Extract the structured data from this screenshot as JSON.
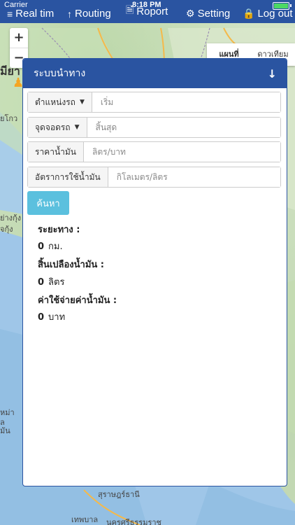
{
  "status": {
    "carrier": "Carrier",
    "time": "8:18 PM"
  },
  "nav": {
    "items": [
      {
        "label": "Real tim",
        "icon": "rss-icon"
      },
      {
        "label": "Routing",
        "icon": "arrow-up-icon"
      },
      {
        "label": "Roport",
        "icon": "document-icon"
      },
      {
        "label": "Setting",
        "icon": "gears-icon"
      },
      {
        "label": "Log out",
        "icon": "lock-icon"
      }
    ]
  },
  "map": {
    "zoom_in": "+",
    "zoom_out": "−",
    "map_type_options": [
      "แผนที่",
      "ดาวเทียม"
    ],
    "places": [
      "มียา",
      "ยโกว",
      "ย่างกุ้ง",
      "จกุ้ง",
      "เทพบาล",
      "นครศรีธรรมราช",
      "สุราษฎร์ธานี",
      "หม่า",
      "ล",
      "มัน"
    ]
  },
  "panel": {
    "title": "ระบบนำทาง",
    "collapse_icon": "arrow-down-icon",
    "start": {
      "dropdown": "ตำแหน่งรถ",
      "placeholder": "เริ่ม"
    },
    "end": {
      "dropdown": "จุดจอดรถ",
      "placeholder": "สิ้นสุด"
    },
    "fuel_price": {
      "label": "ราคาน้ำมัน",
      "placeholder": "ลิตร/บาท"
    },
    "fuel_rate": {
      "label": "อัตราการใช้น้ำมัน",
      "placeholder": "กิโลเมตร/ลิตร"
    },
    "search_button": "ค้นหา",
    "results": {
      "distance_label": "ระยะทาง :",
      "distance_value": "0",
      "distance_unit": "กม.",
      "fuel_label": "สิ้นเปลืองน้ำมัน :",
      "fuel_value": "0",
      "fuel_unit": "ลิตร",
      "cost_label": "ค่าใช้จ่ายค่าน้ำมัน :",
      "cost_value": "0",
      "cost_unit": "บาท"
    }
  },
  "colors": {
    "header_blue": "#2a54a1",
    "button_cyan": "#5bc0de",
    "sea_blue": "#9fc6e8"
  }
}
